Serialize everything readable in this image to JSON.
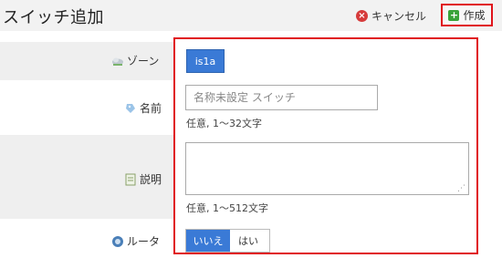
{
  "header": {
    "title": "スイッチ追加",
    "cancel_label": "キャンセル",
    "create_label": "作成"
  },
  "fields": {
    "zone": {
      "label": "ゾーン",
      "value": "is1a"
    },
    "name": {
      "label": "名前",
      "placeholder": "名称未設定 スイッチ",
      "hint": "任意, 1〜32文字"
    },
    "description": {
      "label": "説明",
      "hint": "任意, 1〜512文字"
    },
    "router": {
      "label": "ルータ",
      "option_no": "いいえ",
      "option_yes": "はい",
      "selected": "いいえ"
    }
  },
  "colors": {
    "accent": "#3a7ad6",
    "highlight": "#e0131b"
  }
}
